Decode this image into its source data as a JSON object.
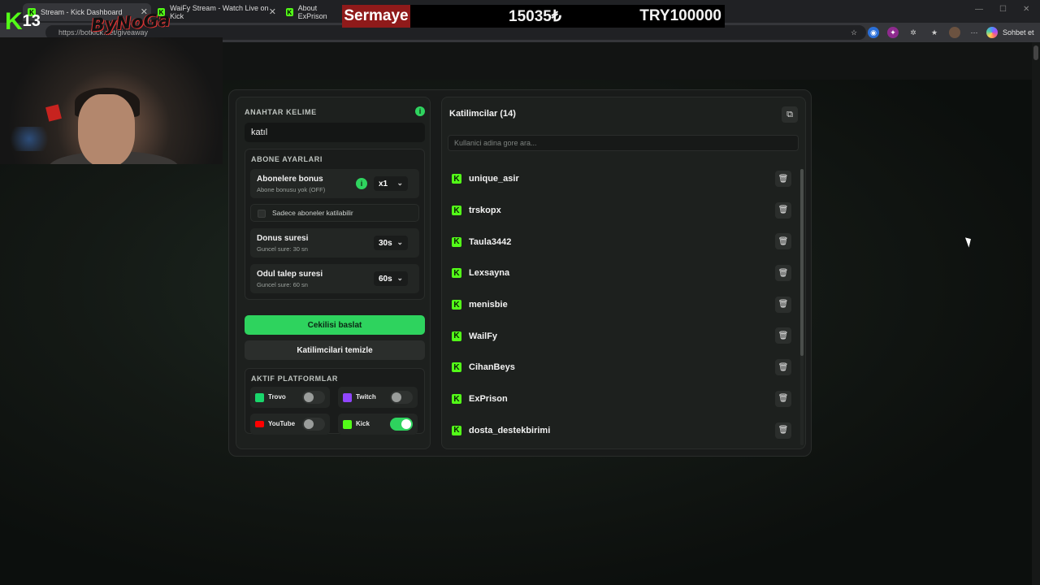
{
  "browser": {
    "tabs": [
      {
        "title": "Stream - Kick Dashboard"
      },
      {
        "title": "WaiFy Stream - Watch Live on Kick"
      },
      {
        "title": "About ExPrison"
      }
    ],
    "url": "https://botkick.net/giveaway",
    "profile_button": "Sohbet et"
  },
  "overlay": {
    "logo_k": "K",
    "logo_num": "13",
    "bynoga": "ByNoGa",
    "sermaye_label": "Sermaye",
    "sermaye_value": "15035₺",
    "sermaye_target": "TRY100000"
  },
  "left": {
    "keyword_title": "ANAHTAR KELIME",
    "keyword_value": "katıl",
    "sub_title": "ABONE AYARLARI",
    "sub_bonus_title": "Abonelere bonus",
    "sub_bonus_sub": "Abone bonusu yok (OFF)",
    "sub_bonus_select": "x1",
    "sub_only_label": "Sadece aboneler katilabilir",
    "bonus_title": "Donus suresi",
    "bonus_sub": "Guncel sure: 30 sn",
    "bonus_select": "30s",
    "claim_title": "Odul talep suresi",
    "claim_sub": "Guncel sure: 60 sn",
    "claim_select": "60s",
    "start_button": "Cekilisi baslat",
    "clear_button": "Katilimcilari temizle",
    "platforms_title": "AKTIF PLATFORMLAR",
    "platforms": [
      {
        "name": "Trovo",
        "on": false,
        "color": "#19d66b"
      },
      {
        "name": "Twitch",
        "on": false,
        "color": "#9146ff"
      },
      {
        "name": "YouTube",
        "on": false,
        "color": "#ff0000"
      },
      {
        "name": "Kick",
        "on": true,
        "color": "#53fc18"
      }
    ]
  },
  "right": {
    "title": "Katilimcilar (14)",
    "search_placeholder": "Kullanici adina gore ara...",
    "participants": [
      "unique_asir",
      "trskopx",
      "Taula3442",
      "Lexsayna",
      "menisbie",
      "WailFy",
      "CihanBeys",
      "ExPrison",
      "dosta_destekbirimi"
    ]
  },
  "colors": {
    "accent": "#2ed35e",
    "kick": "#53fc18"
  }
}
